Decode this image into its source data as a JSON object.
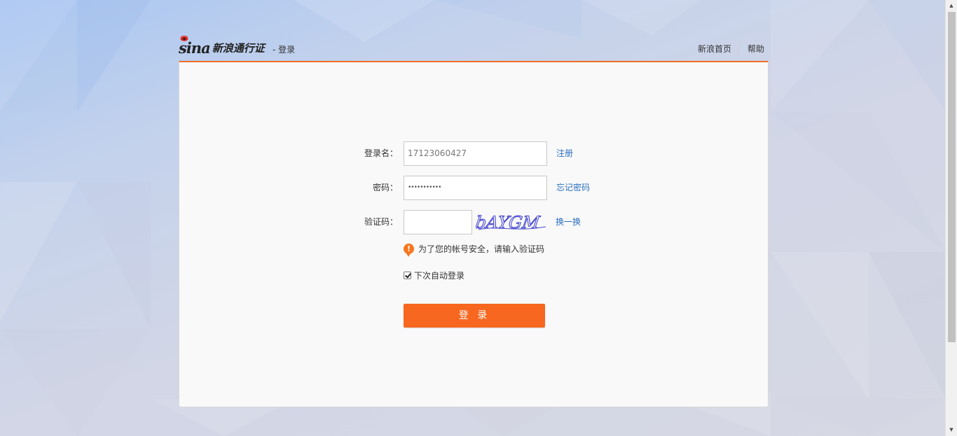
{
  "header": {
    "logo_wordmark": "sina",
    "product_name": "新浪通行证",
    "page_tag": "- 登录",
    "links": [
      {
        "label": "新浪首页"
      },
      {
        "label": "帮助"
      }
    ]
  },
  "form": {
    "username": {
      "label": "登录名：",
      "value": "17123060427",
      "link": "注册"
    },
    "password": {
      "label": "密码：",
      "masked_value": "•••••••••••",
      "link": "忘记密码"
    },
    "captcha": {
      "label": "验证码：",
      "value": "",
      "image_text": "bAYGM",
      "refresh_link": "换一换"
    },
    "warning": {
      "icon": "exclamation-icon",
      "text": "为了您的帐号安全，请输入验证码"
    },
    "remember_me": {
      "checked": true,
      "label": "下次自动登录"
    },
    "submit_label": "登 录"
  },
  "colors": {
    "accent": "#f76720",
    "link": "#2a6fbf",
    "card_border_top": "#f26d26"
  }
}
